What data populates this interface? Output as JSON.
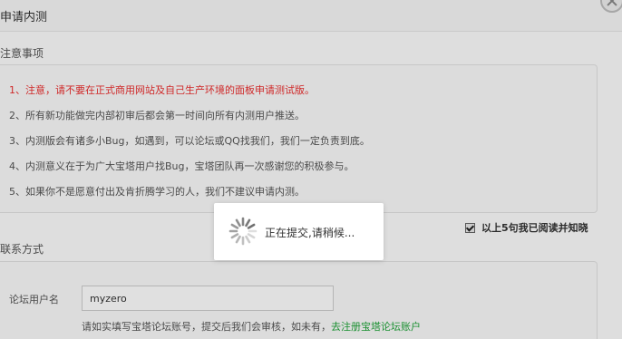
{
  "dialog": {
    "title": "申请内测"
  },
  "notes": {
    "title": "注意事项",
    "items": [
      "1、注意，请不要在正式商用网站及自己生产环境的面板申请测试版。",
      "2、所有新功能做完内部初审后都会第一时间向所有内测用户推送。",
      "3、内测版会有诸多小Bug，如遇到，可以论坛或QQ找我们，我们一定负责到底。",
      "4、内测意义在于为广大宝塔用户找Bug，宝塔团队再一次感谢您的积极参与。",
      "5、如果你不是愿意付出及肯折腾学习的人，我们不建议申请内测。"
    ],
    "warning_color": "#ec2f2f"
  },
  "agree": {
    "checked": true,
    "label": "以上5句我已阅读并知晓"
  },
  "contact": {
    "title": "联系方式",
    "username_label": "论坛用户名",
    "username_value": "myzero",
    "hint_text": "请如实填写宝塔论坛账号，提交后我们会审核，如未有，",
    "hint_link": "去注册宝塔论坛账户",
    "link_color": "#20a53a"
  },
  "loading": {
    "text": "正在提交,请稍候...",
    "icon": "spinner-icon"
  }
}
